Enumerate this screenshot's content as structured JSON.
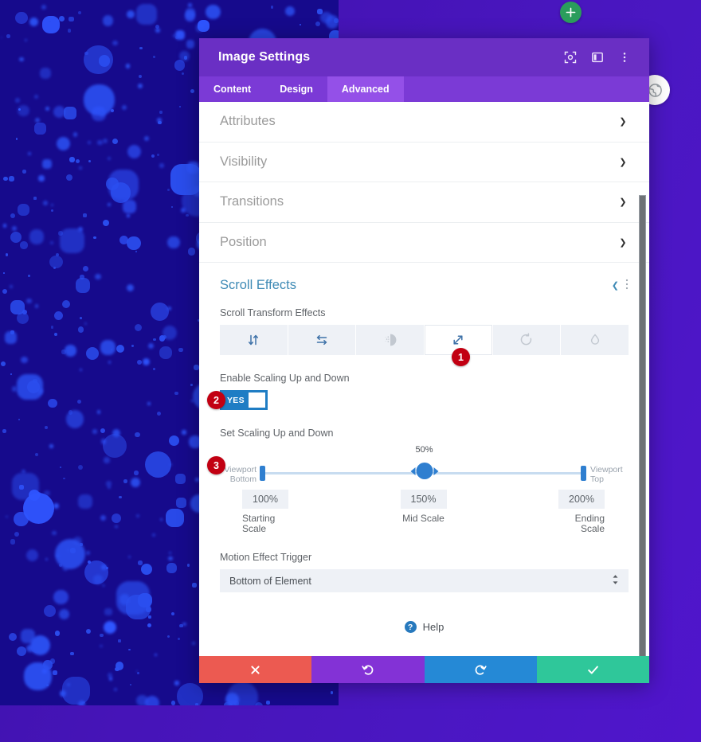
{
  "canvas": {
    "add_button_icon": "plus-icon",
    "side_round_button_icon": "globe-settings-icon",
    "background_color": "#4614b8",
    "splatter_color": "#160a8c",
    "splatter_dot_color": "#2b4ff0"
  },
  "modal": {
    "title": "Image Settings",
    "header_icons": [
      {
        "name": "focus-target-icon",
        "glyph": "focus"
      },
      {
        "name": "layout-panel-icon",
        "glyph": "panel"
      },
      {
        "name": "kebab-menu-icon",
        "glyph": "kebab"
      }
    ],
    "tabs": [
      {
        "label": "Content",
        "active": false
      },
      {
        "label": "Design",
        "active": false
      },
      {
        "label": "Advanced",
        "active": true
      }
    ],
    "collapsed_sections": [
      {
        "label": "Attributes",
        "chevron": "chevron-down-icon"
      },
      {
        "label": "Visibility",
        "chevron": "chevron-down-icon"
      },
      {
        "label": "Transitions",
        "chevron": "chevron-down-icon"
      },
      {
        "label": "Position",
        "chevron": "chevron-down-icon"
      }
    ],
    "scroll_effects": {
      "section_title": "Scroll Effects",
      "section_chevron": "chevron-up-icon",
      "section_kebab": "kebab-menu-icon",
      "transform_effects_label": "Scroll Transform Effects",
      "effects": [
        {
          "name": "vertical-motion-icon",
          "active": false,
          "muted": false
        },
        {
          "name": "horizontal-motion-icon",
          "active": false,
          "muted": false
        },
        {
          "name": "fade-in-out-icon",
          "active": false,
          "muted": true
        },
        {
          "name": "scaling-icon",
          "active": true,
          "muted": false
        },
        {
          "name": "rotating-icon",
          "active": false,
          "muted": true
        },
        {
          "name": "blur-icon",
          "active": false,
          "muted": true
        }
      ],
      "enable_label": "Enable Scaling Up and Down",
      "toggle_value": "YES",
      "toggle_color": "#1f7dc4",
      "set_scaling_label": "Set Scaling Up and Down",
      "slider": {
        "midpoint_value": "50%",
        "left_endpoint_label_line1": "Viewport",
        "left_endpoint_label_line2": "Bottom",
        "right_endpoint_label_line1": "Viewport",
        "right_endpoint_label_line2": "Top",
        "thumb_position_percent": 50,
        "accent_color": "#2f7fd0",
        "track_color": "#c7dcf0"
      },
      "scales": [
        {
          "value": "100%",
          "caption_line1": "Starting",
          "caption_line2": "Scale"
        },
        {
          "value": "150%",
          "caption_line1": "Mid Scale",
          "caption_line2": ""
        },
        {
          "value": "200%",
          "caption_line1": "Ending",
          "caption_line2": "Scale"
        }
      ],
      "trigger_label": "Motion Effect Trigger",
      "trigger_value": "Bottom of Element",
      "trigger_icon": "select-arrows-icon"
    },
    "help": {
      "label": "Help",
      "icon": "question-mark-icon"
    },
    "footer_buttons": [
      {
        "name": "cancel-button",
        "icon": "close-x-icon",
        "color": "#ec5a51"
      },
      {
        "name": "undo-button",
        "icon": "undo-arrow-icon",
        "color": "#8332d6"
      },
      {
        "name": "redo-button",
        "icon": "redo-arrow-icon",
        "color": "#2589d6"
      },
      {
        "name": "save-button",
        "icon": "checkmark-icon",
        "color": "#2fc79a"
      }
    ]
  },
  "markers": [
    {
      "number": "1",
      "target": "scaling-effect-button"
    },
    {
      "number": "2",
      "target": "enable-scaling-toggle"
    },
    {
      "number": "3",
      "target": "set-scaling-slider"
    }
  ]
}
